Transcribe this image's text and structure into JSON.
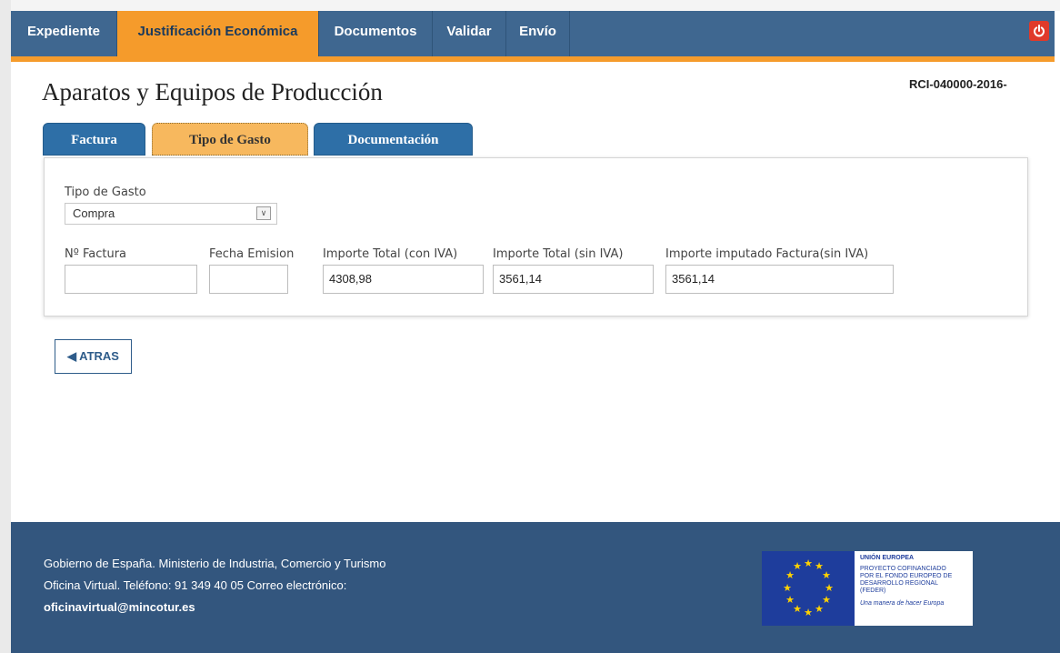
{
  "nav": {
    "items": [
      {
        "label": "Expediente"
      },
      {
        "label": "Justificación Económica"
      },
      {
        "label": "Documentos"
      },
      {
        "label": "Validar"
      },
      {
        "label": "Envío"
      }
    ],
    "active_index": 1
  },
  "page": {
    "title": "Aparatos y Equipos de Producción",
    "record_id": "RCI-040000-2016-"
  },
  "tabs": [
    {
      "label": "Factura"
    },
    {
      "label": "Tipo de Gasto"
    },
    {
      "label": "Documentación"
    }
  ],
  "active_tab": 1,
  "form": {
    "tipo_gasto": {
      "label": "Tipo de Gasto",
      "value": "Compra"
    },
    "n_factura": {
      "label": "Nº Factura",
      "value": ""
    },
    "fecha_emision": {
      "label": "Fecha Emision",
      "value": ""
    },
    "importe_total_con_iva": {
      "label": "Importe Total (con IVA)",
      "value": "4308,98"
    },
    "importe_total_sin_iva": {
      "label": "Importe Total (sin IVA)",
      "value": "3561,14"
    },
    "importe_imputado": {
      "label": "Importe imputado Factura(sin IVA)",
      "value": "3561,14"
    }
  },
  "back_button": {
    "label": "ATRAS"
  },
  "footer": {
    "line1": "Gobierno de España. Ministerio de Industria, Comercio y Turismo",
    "line2": "Oficina Virtual. Teléfono: 91 349 40 05   Correo electrónico:",
    "email": "oficinavirtual@mincotur.es",
    "eu_logo": {
      "heading": "UNIÓN EUROPEA",
      "line1": "PROYECTO COFINANCIADO",
      "line2": "POR EL FONDO EUROPEO DE",
      "line3": "DESARROLLO REGIONAL",
      "line4": "(FEDER)",
      "slogan": "Una manera de hacer Europa"
    }
  },
  "colors": {
    "nav_bg": "#3f6790",
    "accent_orange": "#f59b2b",
    "tab_blue": "#2e6fa7",
    "footer_bg": "#33567e",
    "power_red": "#e03a2a"
  },
  "icons": {
    "power": "power-icon",
    "back_arrow": "chevron-left-icon",
    "select_arrow": "chevron-down-icon"
  }
}
